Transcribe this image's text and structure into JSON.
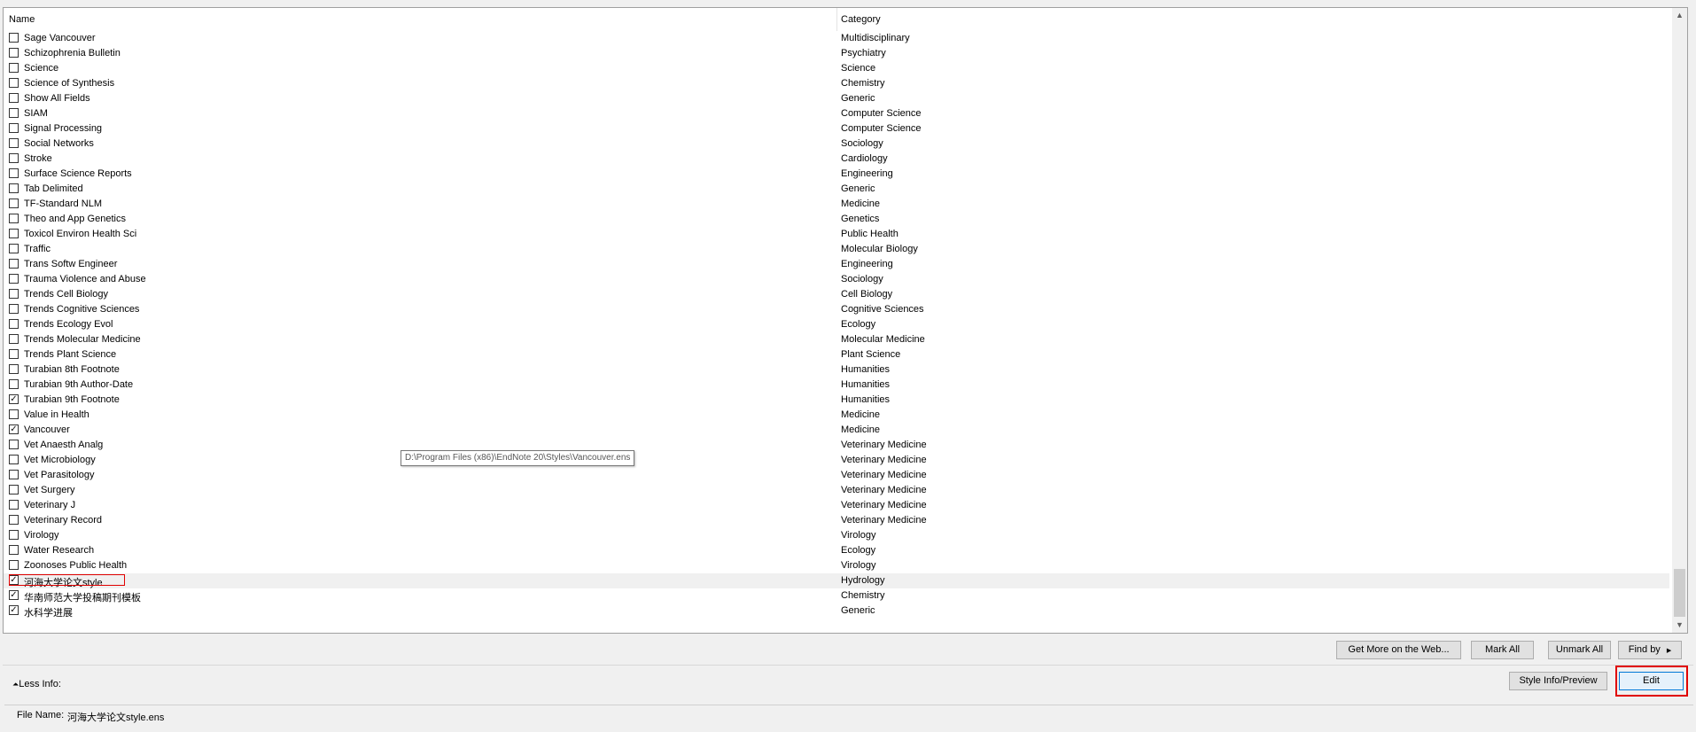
{
  "table": {
    "col_name": "Name",
    "col_category": "Category",
    "rows": [
      {
        "name": "Sage Vancouver",
        "category": "Multidisciplinary",
        "checked": false
      },
      {
        "name": "Schizophrenia Bulletin",
        "category": "Psychiatry",
        "checked": false
      },
      {
        "name": "Science",
        "category": "Science",
        "checked": false
      },
      {
        "name": "Science of Synthesis",
        "category": "Chemistry",
        "checked": false
      },
      {
        "name": "Show All Fields",
        "category": "Generic",
        "checked": false
      },
      {
        "name": "SIAM",
        "category": "Computer Science",
        "checked": false
      },
      {
        "name": "Signal Processing",
        "category": "Computer Science",
        "checked": false
      },
      {
        "name": "Social Networks",
        "category": "Sociology",
        "checked": false
      },
      {
        "name": "Stroke",
        "category": "Cardiology",
        "checked": false
      },
      {
        "name": "Surface Science Reports",
        "category": "Engineering",
        "checked": false
      },
      {
        "name": "Tab Delimited",
        "category": "Generic",
        "checked": false
      },
      {
        "name": "TF-Standard NLM",
        "category": "Medicine",
        "checked": false
      },
      {
        "name": "Theo and App Genetics",
        "category": "Genetics",
        "checked": false
      },
      {
        "name": "Toxicol Environ Health Sci",
        "category": "Public Health",
        "checked": false
      },
      {
        "name": "Traffic",
        "category": "Molecular Biology",
        "checked": false
      },
      {
        "name": "Trans Softw Engineer",
        "category": "Engineering",
        "checked": false
      },
      {
        "name": "Trauma Violence and Abuse",
        "category": "Sociology",
        "checked": false
      },
      {
        "name": "Trends Cell Biology",
        "category": "Cell Biology",
        "checked": false
      },
      {
        "name": "Trends Cognitive Sciences",
        "category": "Cognitive Sciences",
        "checked": false
      },
      {
        "name": "Trends Ecology Evol",
        "category": "Ecology",
        "checked": false
      },
      {
        "name": "Trends Molecular Medicine",
        "category": "Molecular Medicine",
        "checked": false
      },
      {
        "name": "Trends Plant Science",
        "category": "Plant Science",
        "checked": false
      },
      {
        "name": "Turabian 8th Footnote",
        "category": "Humanities",
        "checked": false
      },
      {
        "name": "Turabian 9th Author-Date",
        "category": "Humanities",
        "checked": false
      },
      {
        "name": "Turabian 9th Footnote",
        "category": "Humanities",
        "checked": true
      },
      {
        "name": "Value in Health",
        "category": "Medicine",
        "checked": false
      },
      {
        "name": "Vancouver",
        "category": "Medicine",
        "checked": true
      },
      {
        "name": "Vet Anaesth Analg",
        "category": "Veterinary Medicine",
        "checked": false
      },
      {
        "name": "Vet Microbiology",
        "category": "Veterinary Medicine",
        "checked": false
      },
      {
        "name": "Vet Parasitology",
        "category": "Veterinary Medicine",
        "checked": false
      },
      {
        "name": "Vet Surgery",
        "category": "Veterinary Medicine",
        "checked": false
      },
      {
        "name": "Veterinary J",
        "category": "Veterinary Medicine",
        "checked": false
      },
      {
        "name": "Veterinary Record",
        "category": "Veterinary Medicine",
        "checked": false
      },
      {
        "name": "Virology",
        "category": "Virology",
        "checked": false
      },
      {
        "name": "Water Research",
        "category": "Ecology",
        "checked": false
      },
      {
        "name": "Zoonoses Public Health",
        "category": "Virology",
        "checked": false
      },
      {
        "name": "河海大学论文style",
        "category": "Hydrology",
        "checked": true,
        "selected": true,
        "highlighted": true
      },
      {
        "name": "华南师范大学投稿期刊模板",
        "category": "Chemistry",
        "checked": true
      },
      {
        "name": "水科学进展",
        "category": "Generic",
        "checked": true
      }
    ]
  },
  "tooltip": "D:\\Program Files (x86)\\EndNote 20\\Styles\\Vancouver.ens",
  "buttons": {
    "get_more": "Get More on the Web...",
    "mark_all": "Mark All",
    "unmark_all": "Unmark All",
    "find_by": "Find by",
    "style_info": "Style Info/Preview",
    "edit": "Edit"
  },
  "less_info": "Less Info:",
  "file_name_label": "File Name:",
  "file_name_value": "河海大学论文style.ens",
  "icons": {
    "check": "check-icon",
    "scroll_up": "chevron-up-icon",
    "scroll_down": "chevron-down-icon",
    "find_arrow": "triangle-right-icon",
    "less_info": "double-chevron-up-icon"
  },
  "colors": {
    "highlight_box": "#e00000",
    "selected_row": "#f0f0f0",
    "default_button_border": "#0078d7"
  }
}
